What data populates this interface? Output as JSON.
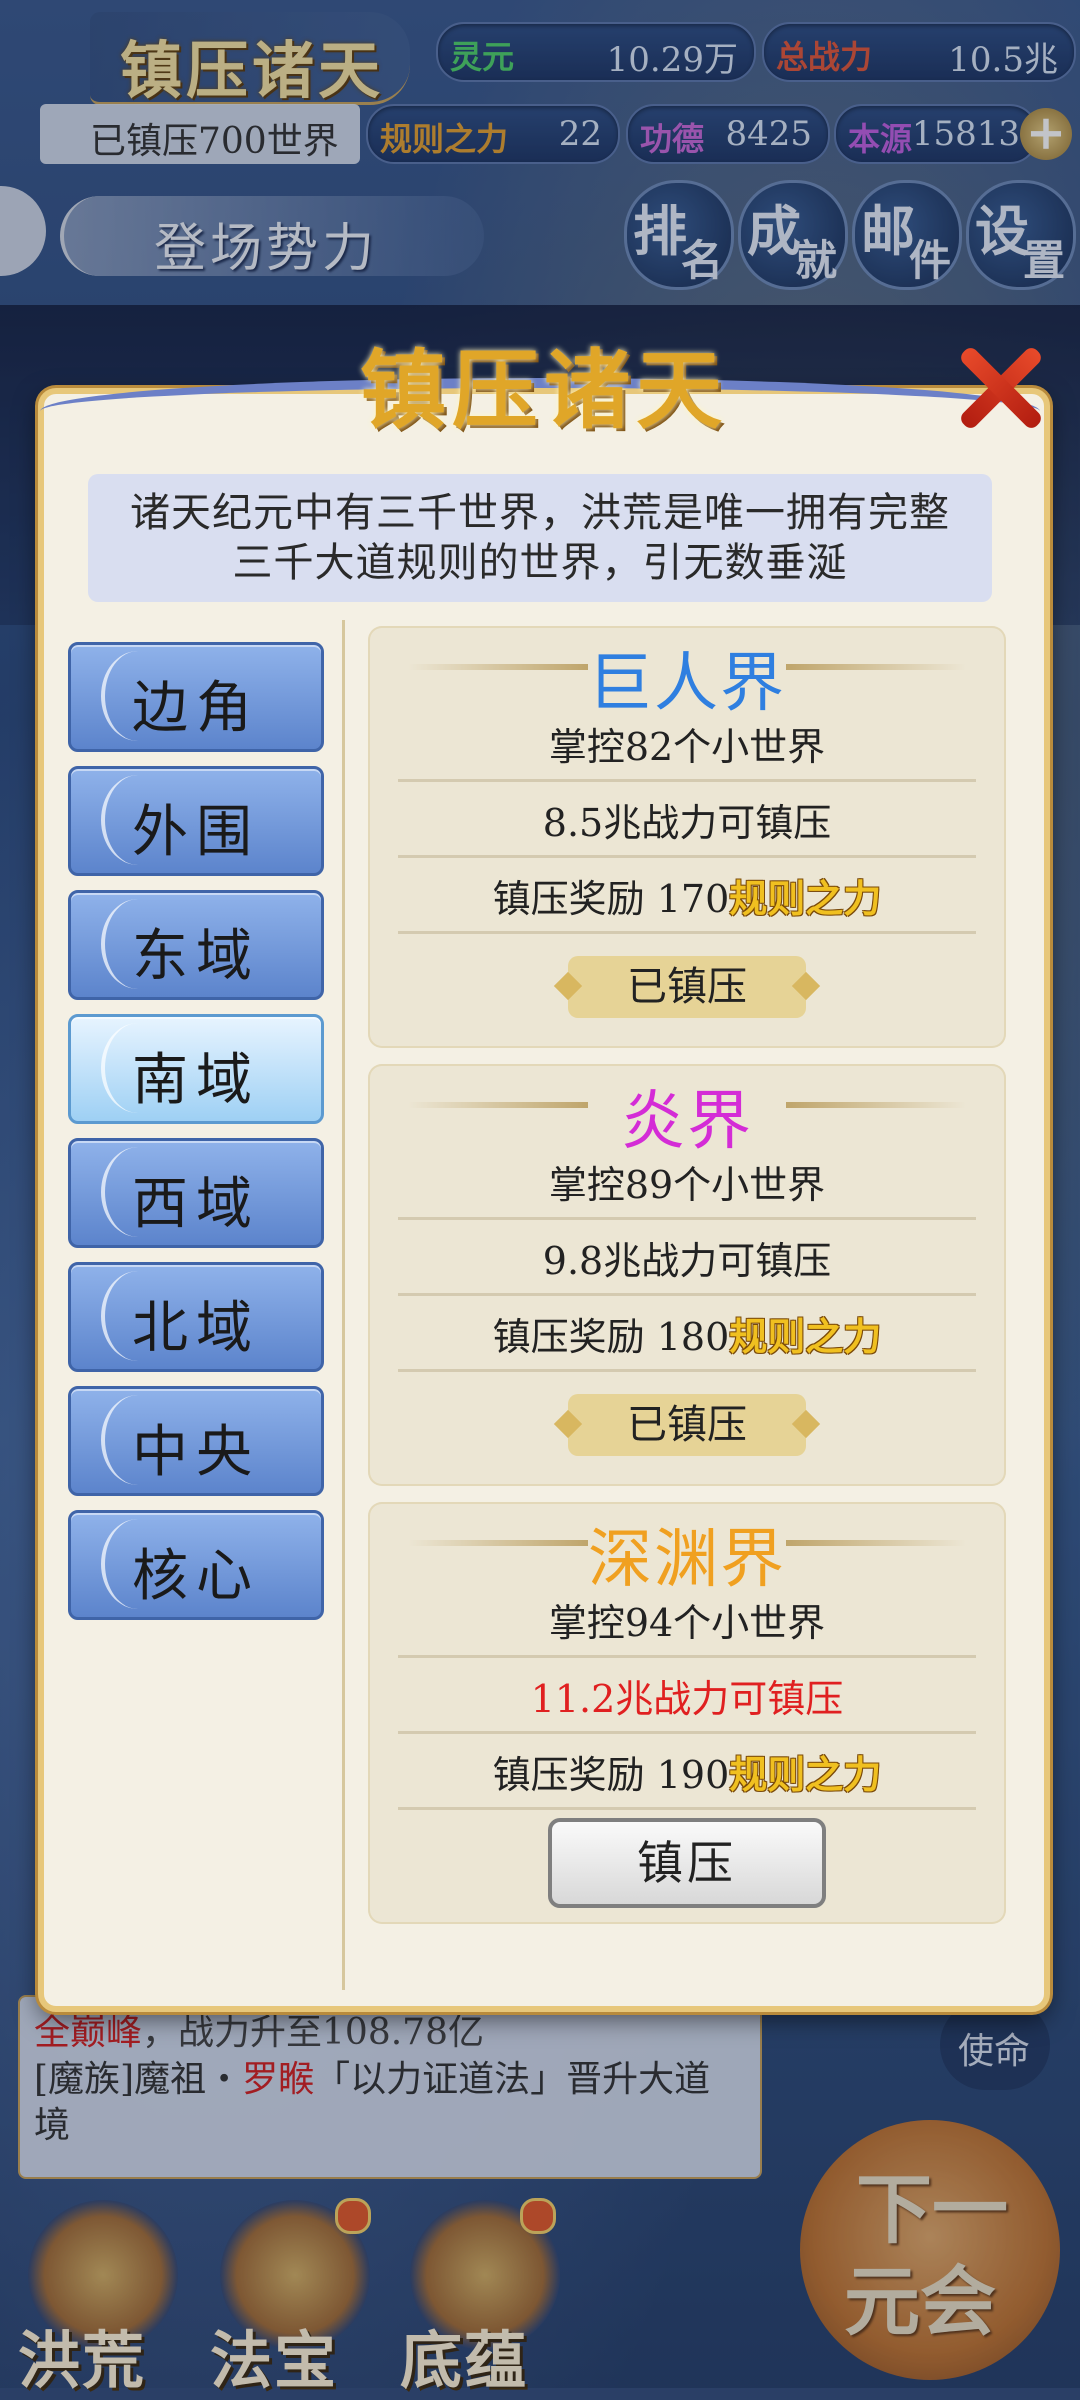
{
  "hud": {
    "title": "镇压诸天",
    "suppressed_count": "已镇压700世界",
    "resources": [
      {
        "label": "灵元",
        "value": "10.29万",
        "color": "#4fd16a"
      },
      {
        "label": "总战力",
        "value": "10.5兆",
        "color": "#e0573a"
      },
      {
        "label": "规则之力",
        "value": "22",
        "color": "#e3a030"
      },
      {
        "label": "功德",
        "value": "8425",
        "color": "#c96ad8"
      },
      {
        "label": "本源",
        "value": "15813",
        "color": "#c060e0"
      }
    ],
    "faction_label": "登场势力",
    "buttons": [
      {
        "a": "排",
        "b": "名"
      },
      {
        "a": "成",
        "b": "就"
      },
      {
        "a": "邮",
        "b": "件"
      },
      {
        "a": "设",
        "b": "置"
      }
    ]
  },
  "modal": {
    "title": "镇压诸天",
    "intro": "诸天纪元中有三千世界，洪荒是唯一拥有完整三千大道规则的世界，引无数垂涎",
    "zones": [
      "边角",
      "外围",
      "东域",
      "南域",
      "西域",
      "北域",
      "中央",
      "核心"
    ],
    "active_zone": "南域",
    "worlds": [
      {
        "name": "巨人界",
        "name_color": "#2f7fe0",
        "control": "掌控82个小世界",
        "power": "8.5兆战力可镇压",
        "power_red": false,
        "reward_prefix": "镇压奖励 170",
        "reward_unit": "规则之力",
        "status": "已镇压"
      },
      {
        "name": "炎界",
        "name_color": "#d42cd6",
        "control": "掌控89个小世界",
        "power": "9.8兆战力可镇压",
        "power_red": false,
        "reward_prefix": "镇压奖励 180",
        "reward_unit": "规则之力",
        "status": "已镇压"
      },
      {
        "name": "深渊界",
        "name_color": "#f0a020",
        "control": "掌控94个小世界",
        "power": "11.2兆战力可镇压",
        "power_red": true,
        "reward_prefix": "镇压奖励 190",
        "reward_unit": "规则之力",
        "status": "镇压"
      }
    ]
  },
  "log": {
    "line1_red": "全巅峰",
    "line1_rest": "，战力升至108.78亿",
    "line2_a": "[魔族]魔祖・",
    "line2_red": "罗睺",
    "line2_b": "「以力证道法」晋升大道境"
  },
  "mission_label": "使命",
  "next_era": {
    "line1": "下一",
    "line2": "元会"
  },
  "nav": [
    "洪荒",
    "法宝",
    "底蕴"
  ]
}
